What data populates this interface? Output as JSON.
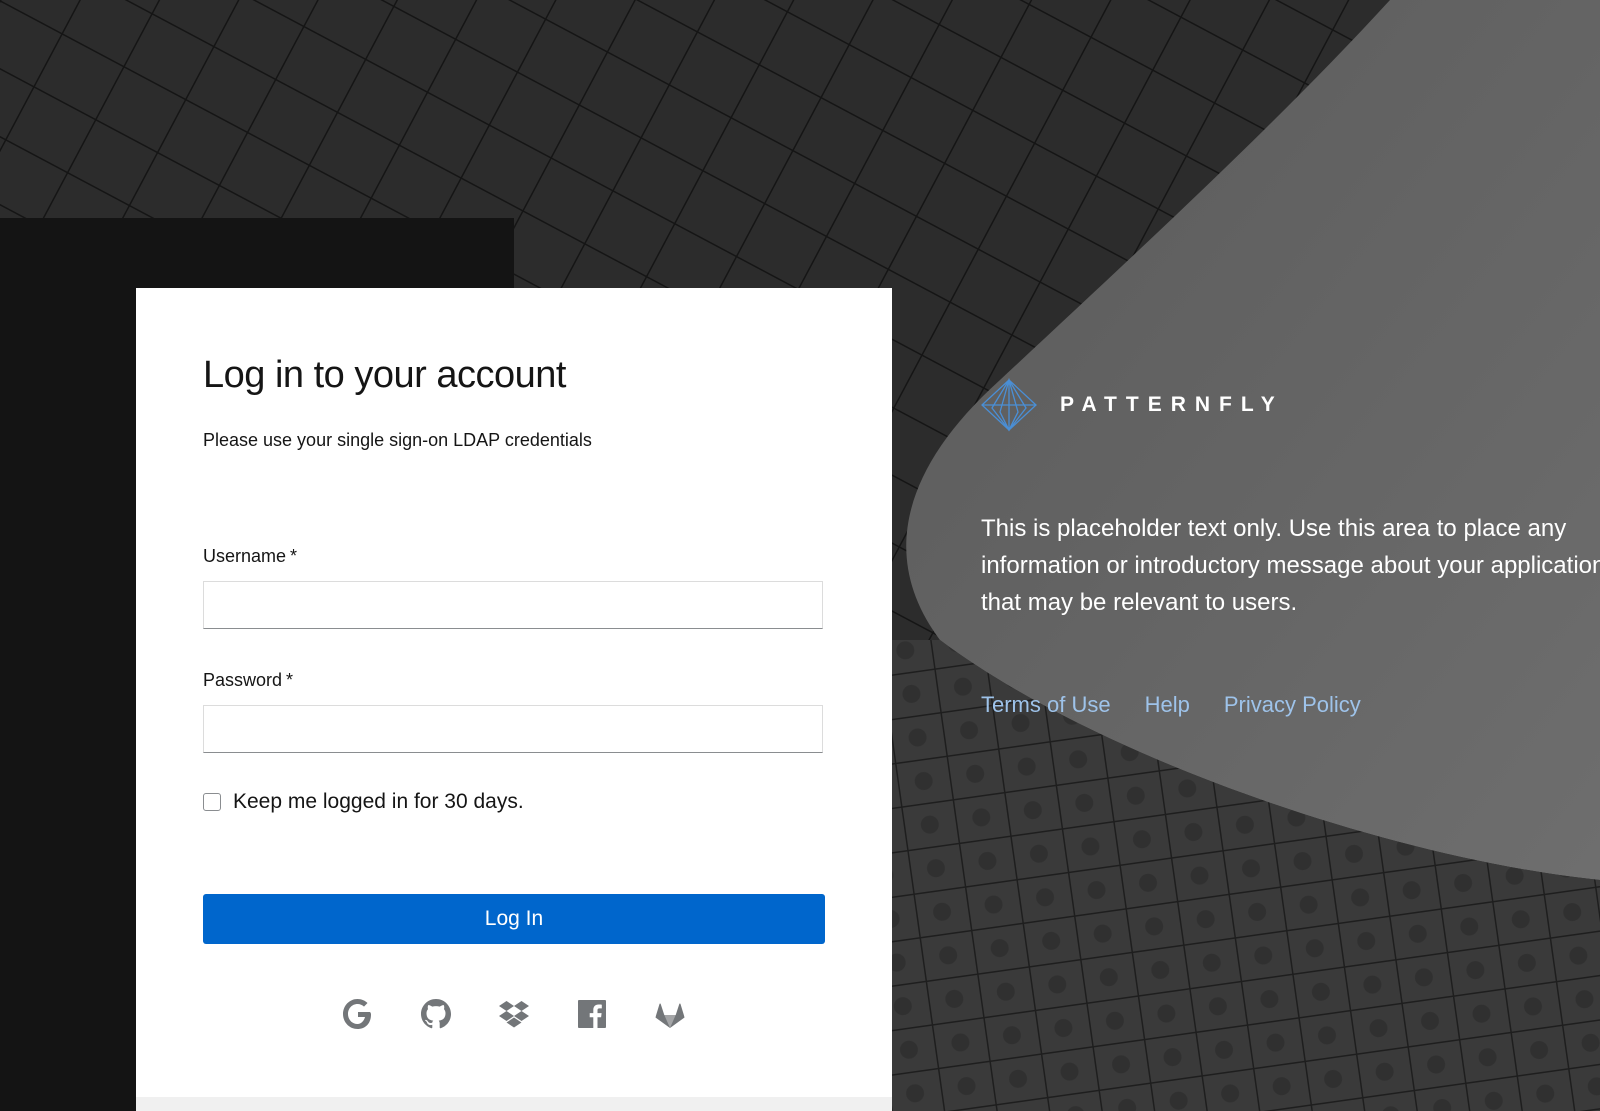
{
  "login": {
    "title": "Log in to your account",
    "subtitle": "Please use your single sign-on LDAP credentials",
    "username_label": "Username",
    "password_label": "Password",
    "required_marker": "*",
    "username_value": "",
    "password_value": "",
    "remember_label": "Keep me logged in for 30 days.",
    "remember_checked": false,
    "submit_label": "Log In",
    "social_icons": [
      "google-icon",
      "github-icon",
      "dropbox-icon",
      "facebook-icon",
      "gitlab-icon"
    ]
  },
  "brand": {
    "name": "PATTERNFLY",
    "logo_icon": "patternfly-logo-icon"
  },
  "info": {
    "text": "This is placeholder text only. Use this area to place any information or introductory message about your application that may be relevant to users."
  },
  "footer": {
    "links": [
      "Terms of Use",
      "Help",
      "Privacy Policy"
    ]
  },
  "colors": {
    "primary": "#0066cc",
    "link": "#9ec3ea",
    "background": "#262626"
  }
}
